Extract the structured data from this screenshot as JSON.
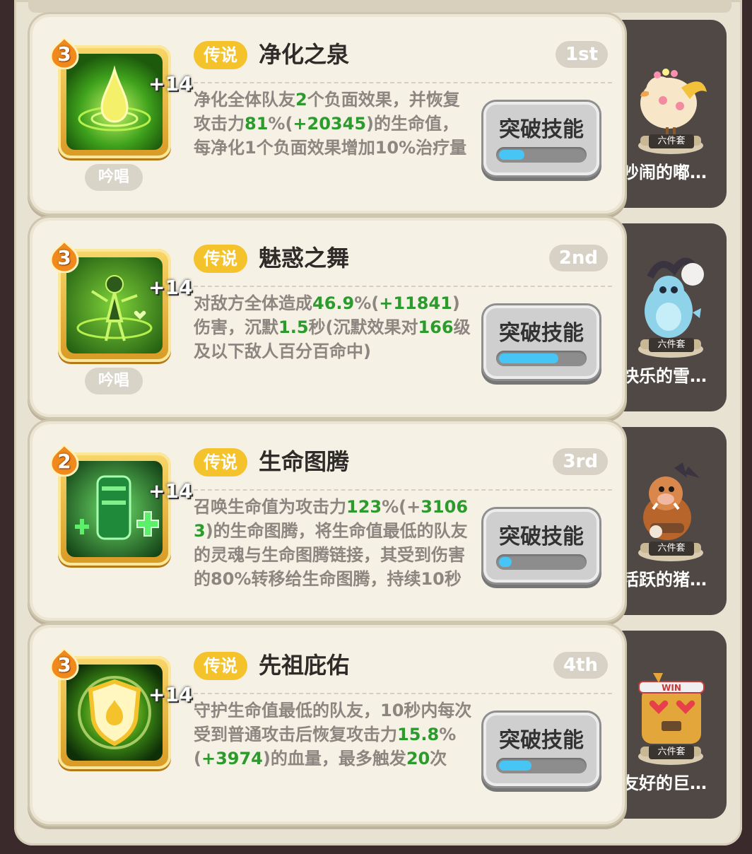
{
  "rarity_label": "传说",
  "chant_label": "吟唱",
  "break_label": "突破技能",
  "set_label": "六件套",
  "icon_level_bonus": "+14",
  "colors": {
    "green_value": "#2c9a2c",
    "rarity": "#f4c22b",
    "progress": "#47c5f4"
  },
  "skills": [
    {
      "rank": "1st",
      "level": "3",
      "name": "净化之泉",
      "icon": "water-drop-icon",
      "has_chant": true,
      "progress": 0.3,
      "desc": [
        {
          "t": "净化全体队友"
        },
        {
          "t": "2",
          "g": true
        },
        {
          "t": "个负面效果，并恢复攻击力"
        },
        {
          "t": "81",
          "g": true
        },
        {
          "t": "%("
        },
        {
          "t": "+20345",
          "g": true
        },
        {
          "t": ")的生命值，每净化1个负面效果增加10%治疗量"
        }
      ],
      "pet_name": "吵闹的嘟…",
      "pet_icon": "yellow-bird-pet-icon"
    },
    {
      "rank": "2nd",
      "level": "3",
      "name": "魅惑之舞",
      "icon": "dancer-icon",
      "has_chant": true,
      "progress": 0.7,
      "desc": [
        {
          "t": "对敌方全体造成"
        },
        {
          "t": "46.9",
          "g": true
        },
        {
          "t": "%("
        },
        {
          "t": "+11841",
          "g": true
        },
        {
          "t": ")伤害，沉默"
        },
        {
          "t": "1.5",
          "g": true
        },
        {
          "t": "秒(沉默效果对"
        },
        {
          "t": "166",
          "g": true
        },
        {
          "t": "级及以下敌人百分百命中)"
        }
      ],
      "pet_name": "快乐的雪…",
      "pet_icon": "blue-yeti-pet-icon"
    },
    {
      "rank": "3rd",
      "level": "2",
      "name": "生命图腾",
      "icon": "totem-icon",
      "has_chant": false,
      "progress": 0.15,
      "desc": [
        {
          "t": "召唤生命值为攻击力"
        },
        {
          "t": "123",
          "g": true
        },
        {
          "t": "%(+"
        },
        {
          "t": "31063",
          "g": true
        },
        {
          "t": ")的生命图腾，将生命值最低的队友的灵魂与生命图腾链接，其受到伤害的80%转移给生命图腾，持续10秒"
        }
      ],
      "pet_name": "活跃的猪…",
      "pet_icon": "boar-pet-icon"
    },
    {
      "rank": "4th",
      "level": "3",
      "name": "先祖庇佑",
      "icon": "shield-icon",
      "has_chant": false,
      "progress": 0.38,
      "desc": [
        {
          "t": "守护生命值最低的队友，10秒内每次受到普通攻击后恢复攻击力"
        },
        {
          "t": "15.8",
          "g": true
        },
        {
          "t": "%("
        },
        {
          "t": "+3974",
          "g": true
        },
        {
          "t": ")的血量，最多触发"
        },
        {
          "t": "20",
          "g": true
        },
        {
          "t": "次"
        }
      ],
      "pet_name": "友好的巨…",
      "pet_icon": "win-robot-pet-icon"
    }
  ]
}
